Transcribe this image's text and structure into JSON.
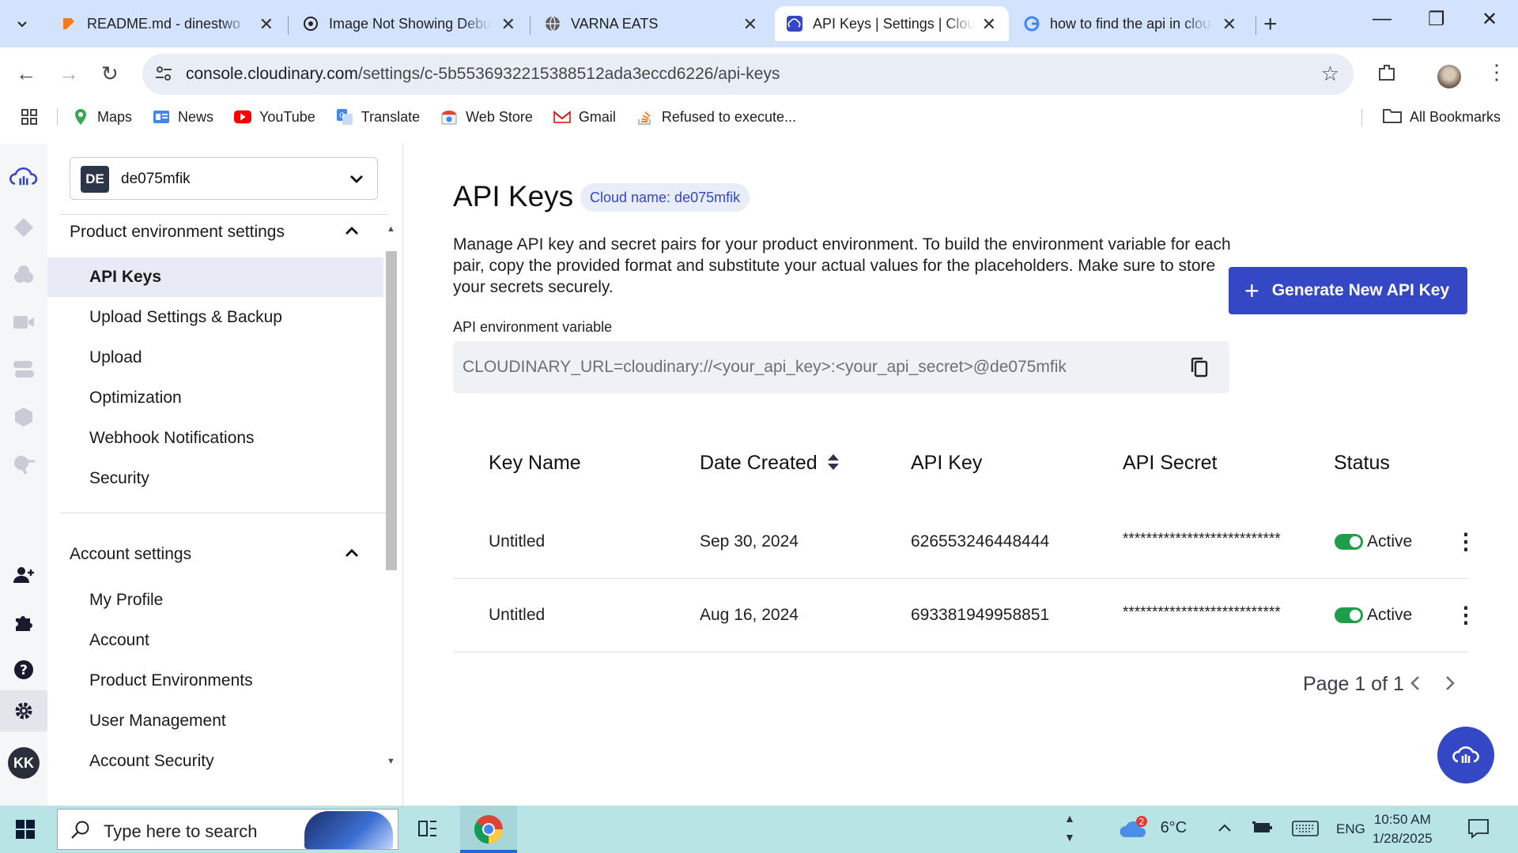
{
  "browser": {
    "tabs": [
      {
        "title": "README.md - dinestwo",
        "favicon": "gitbook-icon"
      },
      {
        "title": "Image Not Showing Debug",
        "favicon": "openai-icon"
      },
      {
        "title": "VARNA EATS",
        "favicon": "globe-icon"
      },
      {
        "title": "API Keys | Settings | Cloudinary",
        "favicon": "cloudinary-icon",
        "active": true
      },
      {
        "title": "how to find the api in cloudinary",
        "favicon": "google-icon"
      }
    ],
    "url_host": "console.cloudinary.com",
    "url_path": "/settings/c-5b5536932215388512ada3eccd6226/api-keys",
    "bookmarks": [
      "Maps",
      "News",
      "YouTube",
      "Translate",
      "Web Store",
      "Gmail",
      "Refused to execute..."
    ],
    "all_bookmarks": "All Bookmarks"
  },
  "sidebar": {
    "env_badge": "DE",
    "env_name": "de075mfik",
    "product_section": "Product environment settings",
    "product_items": [
      "API Keys",
      "Upload Settings & Backup",
      "Upload",
      "Optimization",
      "Webhook Notifications",
      "Security"
    ],
    "account_section": "Account settings",
    "account_items": [
      "My Profile",
      "Account",
      "Product Environments",
      "User Management",
      "Account Security"
    ],
    "user_initials": "KK"
  },
  "main": {
    "title": "API Keys",
    "cloud_name": "Cloud name: de075mfik",
    "description": "Manage API key and secret pairs for your product environment. To build the environment variable for each pair, copy the provided format and substitute your actual values for the placeholders. Make sure to store your secrets securely.",
    "generate_button": "Generate New API Key",
    "env_var_label": "API environment variable",
    "env_var_value": "CLOUDINARY_URL=cloudinary://<your_api_key>:<your_api_secret>@de075mfik",
    "columns": [
      "Key Name",
      "Date Created",
      "API Key",
      "API Secret",
      "Status"
    ],
    "rows": [
      {
        "name": "Untitled",
        "date": "Sep 30, 2024",
        "key": "626553246448444",
        "secret": "***************************",
        "status": "Active"
      },
      {
        "name": "Untitled",
        "date": "Aug 16, 2024",
        "key": "693381949958851",
        "secret": "***************************",
        "status": "Active"
      }
    ],
    "pager": "Page 1 of 1"
  },
  "taskbar": {
    "search_placeholder": "Type here to search",
    "weather_badge": "2",
    "temperature": "6°C",
    "language": "ENG",
    "time": "10:50 AM",
    "date": "1/28/2025"
  },
  "colors": {
    "accent": "#3448c5",
    "active_toggle": "#1e9e4a",
    "tabstrip": "#d3e3fd",
    "taskbar": "#b9e4e6"
  }
}
